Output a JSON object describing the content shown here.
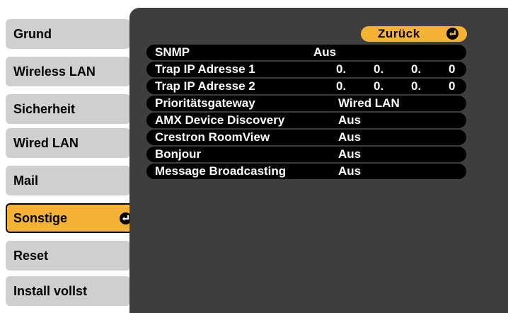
{
  "sidebar": {
    "items": [
      {
        "label": "Grund",
        "active": false
      },
      {
        "label": "Wireless LAN",
        "active": false
      },
      {
        "label": "Sicherheit",
        "active": false
      },
      {
        "label": "Wired LAN",
        "active": false
      },
      {
        "label": "Mail",
        "active": false
      },
      {
        "label": "Sonstige",
        "active": true
      },
      {
        "label": "Reset",
        "active": false
      },
      {
        "label": "Install vollst",
        "active": false
      }
    ]
  },
  "panel": {
    "back_label": "Zurück",
    "settings": [
      {
        "name": "SNMP",
        "value": "Aus"
      },
      {
        "name": "Trap IP Adresse 1",
        "ip": [
          "0.",
          "0.",
          "0.",
          "0"
        ]
      },
      {
        "name": "Trap IP Adresse 2",
        "ip": [
          "0.",
          "0.",
          "0.",
          "0"
        ]
      },
      {
        "name": "Prioritätsgateway",
        "value": "Wired LAN"
      },
      {
        "name": "AMX Device Discovery",
        "value": "Aus"
      },
      {
        "name": "Crestron RoomView",
        "value": "Aus"
      },
      {
        "name": "Bonjour",
        "value": "Aus"
      },
      {
        "name": "Message Broadcasting",
        "value": "Aus"
      }
    ]
  },
  "colors": {
    "accent": "#f5b335",
    "tab": "#cfcfcf",
    "panel": "#3e3e3e",
    "row": "#000000"
  },
  "icons": {
    "enter": "enter-arrow-icon"
  }
}
